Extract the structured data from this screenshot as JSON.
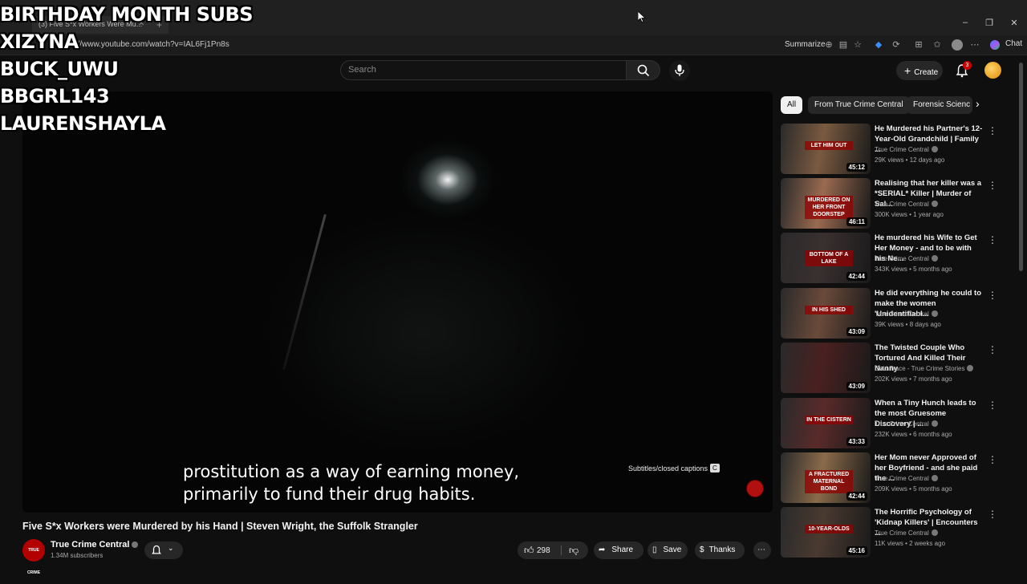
{
  "browser": {
    "tab_title": "(3) Five S*x Workers Were Mu...",
    "url": "https://www.youtube.com/watch?v=IAL6Fj1Pn8s",
    "summarize_label": "Summarize",
    "chat_label": "Chat"
  },
  "overlay": {
    "lines": [
      "BIRTHDAY MONTH SUBS",
      "XIZYNA",
      "BUCK_UWU",
      "BBGRL143",
      "LAURENSHAYLA"
    ]
  },
  "header": {
    "search_placeholder": "Search",
    "create_label": "Create",
    "notification_count": "3"
  },
  "player": {
    "caption_line1": "prostitution as a way of earning money,",
    "caption_line2": "primarily to fund their drug habits.",
    "cc_label": "Subtitles/closed captions",
    "cc_key": "C"
  },
  "video": {
    "title": "Five S*x Workers were Murdered by his Hand | Steven Wright, the Suffolk Strangler",
    "channel": "True Crime Central",
    "subscribers": "1.34M subscribers",
    "channel_avatar_text": "TRUE CRIME",
    "likes": "298",
    "share_label": "Share",
    "save_label": "Save",
    "thanks_label": "Thanks"
  },
  "chips": [
    "All",
    "From True Crime Central",
    "Forensic Scienc"
  ],
  "recommendations": [
    {
      "title": "He Murdered his Partner's 12-Year-Old Grandchild | Family ...",
      "channel": "True Crime Central",
      "meta": "29K views • 12 days ago",
      "duration": "45:12",
      "thumb_text": "LET HIM OUT",
      "color": "#7a5a40"
    },
    {
      "title": "Realising that her killer was a *SERIAL* Killer | Murder of Sal...",
      "channel": "True Crime Central",
      "meta": "300K views • 1 year ago",
      "duration": "46:11",
      "thumb_text": "MURDERED ON HER FRONT DOORSTEP",
      "color": "#9a6a50"
    },
    {
      "title": "He murdered his Wife to Get Her Money - and to be with his Ne...",
      "channel": "True Crime Central",
      "meta": "343K views • 5 months ago",
      "duration": "42:44",
      "thumb_text": "BOTTOM OF A LAKE",
      "color": "#3a3030"
    },
    {
      "title": "He did everything he could to make the women 'Unidentifiabl...",
      "channel": "True Crime Central",
      "meta": "39K views • 8 days ago",
      "duration": "43:09",
      "thumb_text": "IN HIS SHED",
      "color": "#6a4a3a"
    },
    {
      "title": "The Twisted Couple Who Tortured And Killed Their Nanny",
      "channel": "Cold Trace - True Crime Stories",
      "meta": "202K views • 7 months ago",
      "duration": "43:09",
      "thumb_text": "",
      "color": "#4a2020"
    },
    {
      "title": "When a Tiny Hunch leads to the most Gruesome Discovery | ...",
      "channel": "True Crime Central",
      "meta": "232K views • 6 months ago",
      "duration": "43:33",
      "thumb_text": "IN THE CISTERN",
      "color": "#5a2a2a"
    },
    {
      "title": "Her Mom never Approved of her Boyfriend - and she paid the ...",
      "channel": "True Crime Central",
      "meta": "209K views • 5 months ago",
      "duration": "42:44",
      "thumb_text": "A FRACTURED MATERNAL BOND",
      "color": "#8a6a4a"
    },
    {
      "title": "The Horrific Psychology of 'Kidnap Killers' | Encounters ...",
      "channel": "True Crime Central",
      "meta": "11K views • 2 weeks ago",
      "duration": "45:16",
      "thumb_text": "10-YEAR-OLDS",
      "color": "#4a3a30"
    }
  ]
}
